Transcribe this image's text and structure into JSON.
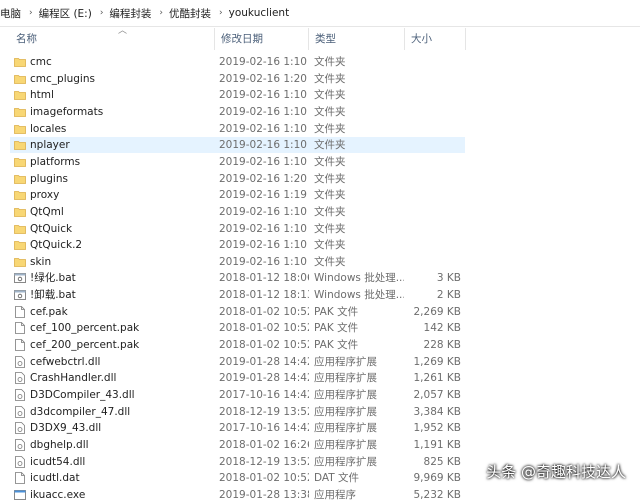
{
  "breadcrumb": [
    "电脑",
    "编程区 (E:)",
    "编程封装",
    "优酷封装",
    "youkuclient"
  ],
  "columns": {
    "name": "名称",
    "date": "修改日期",
    "type": "类型",
    "size": "大小"
  },
  "files": [
    {
      "name": "cmc",
      "date": "2019-02-16 1:10",
      "type": "文件夹",
      "size": "",
      "icon": "folder-icon"
    },
    {
      "name": "cmc_plugins",
      "date": "2019-02-16 1:20",
      "type": "文件夹",
      "size": "",
      "icon": "folder-icon"
    },
    {
      "name": "html",
      "date": "2019-02-16 1:10",
      "type": "文件夹",
      "size": "",
      "icon": "folder-icon"
    },
    {
      "name": "imageformats",
      "date": "2019-02-16 1:10",
      "type": "文件夹",
      "size": "",
      "icon": "folder-icon"
    },
    {
      "name": "locales",
      "date": "2019-02-16 1:10",
      "type": "文件夹",
      "size": "",
      "icon": "folder-icon"
    },
    {
      "name": "nplayer",
      "date": "2019-02-16 1:10",
      "type": "文件夹",
      "size": "",
      "icon": "folder-icon"
    },
    {
      "name": "platforms",
      "date": "2019-02-16 1:10",
      "type": "文件夹",
      "size": "",
      "icon": "folder-icon"
    },
    {
      "name": "plugins",
      "date": "2019-02-16 1:20",
      "type": "文件夹",
      "size": "",
      "icon": "folder-icon"
    },
    {
      "name": "proxy",
      "date": "2019-02-16 1:19",
      "type": "文件夹",
      "size": "",
      "icon": "folder-icon"
    },
    {
      "name": "QtQml",
      "date": "2019-02-16 1:10",
      "type": "文件夹",
      "size": "",
      "icon": "folder-icon"
    },
    {
      "name": "QtQuick",
      "date": "2019-02-16 1:10",
      "type": "文件夹",
      "size": "",
      "icon": "folder-icon"
    },
    {
      "name": "QtQuick.2",
      "date": "2019-02-16 1:10",
      "type": "文件夹",
      "size": "",
      "icon": "folder-icon"
    },
    {
      "name": "skin",
      "date": "2019-02-16 1:10",
      "type": "文件夹",
      "size": "",
      "icon": "folder-icon"
    },
    {
      "name": "!绿化.bat",
      "date": "2018-01-12 18:06",
      "type": "Windows 批处理...",
      "size": "3 KB",
      "icon": "batch-file-icon"
    },
    {
      "name": "!卸载.bat",
      "date": "2018-01-12 18:13",
      "type": "Windows 批处理...",
      "size": "2 KB",
      "icon": "batch-file-icon"
    },
    {
      "name": "cef.pak",
      "date": "2018-01-02 10:52",
      "type": "PAK 文件",
      "size": "2,269 KB",
      "icon": "file-icon"
    },
    {
      "name": "cef_100_percent.pak",
      "date": "2018-01-02 10:52",
      "type": "PAK 文件",
      "size": "142 KB",
      "icon": "file-icon"
    },
    {
      "name": "cef_200_percent.pak",
      "date": "2018-01-02 10:52",
      "type": "PAK 文件",
      "size": "228 KB",
      "icon": "file-icon"
    },
    {
      "name": "cefwebctrl.dll",
      "date": "2019-01-28 14:42",
      "type": "应用程序扩展",
      "size": "1,269 KB",
      "icon": "dll-file-icon"
    },
    {
      "name": "CrashHandler.dll",
      "date": "2019-01-28 14:42",
      "type": "应用程序扩展",
      "size": "1,261 KB",
      "icon": "dll-file-icon"
    },
    {
      "name": "D3DCompiler_43.dll",
      "date": "2017-10-16 14:42",
      "type": "应用程序扩展",
      "size": "2,057 KB",
      "icon": "dll-file-icon"
    },
    {
      "name": "d3dcompiler_47.dll",
      "date": "2018-12-19 13:52",
      "type": "应用程序扩展",
      "size": "3,384 KB",
      "icon": "dll-file-icon"
    },
    {
      "name": "D3DX9_43.dll",
      "date": "2017-10-16 14:42",
      "type": "应用程序扩展",
      "size": "1,952 KB",
      "icon": "dll-file-icon"
    },
    {
      "name": "dbghelp.dll",
      "date": "2018-01-02 16:26",
      "type": "应用程序扩展",
      "size": "1,191 KB",
      "icon": "dll-file-icon"
    },
    {
      "name": "icudt54.dll",
      "date": "2018-12-19 13:52",
      "type": "应用程序扩展",
      "size": "825 KB",
      "icon": "dll-file-icon"
    },
    {
      "name": "icudtl.dat",
      "date": "2018-01-02 10:52",
      "type": "DAT 文件",
      "size": "9,969 KB",
      "icon": "file-icon"
    },
    {
      "name": "ikuacc.exe",
      "date": "2019-01-28 13:38",
      "type": "应用程序",
      "size": "5,232 KB",
      "icon": "exe-file-icon"
    }
  ],
  "hover_index": 5,
  "watermark": "头条 @奇趣科技达人",
  "colors": {
    "folder": "#f8d775",
    "hover": "#e5f3ff",
    "header_text": "#4c607a",
    "muted_text": "#6d6d6d"
  }
}
